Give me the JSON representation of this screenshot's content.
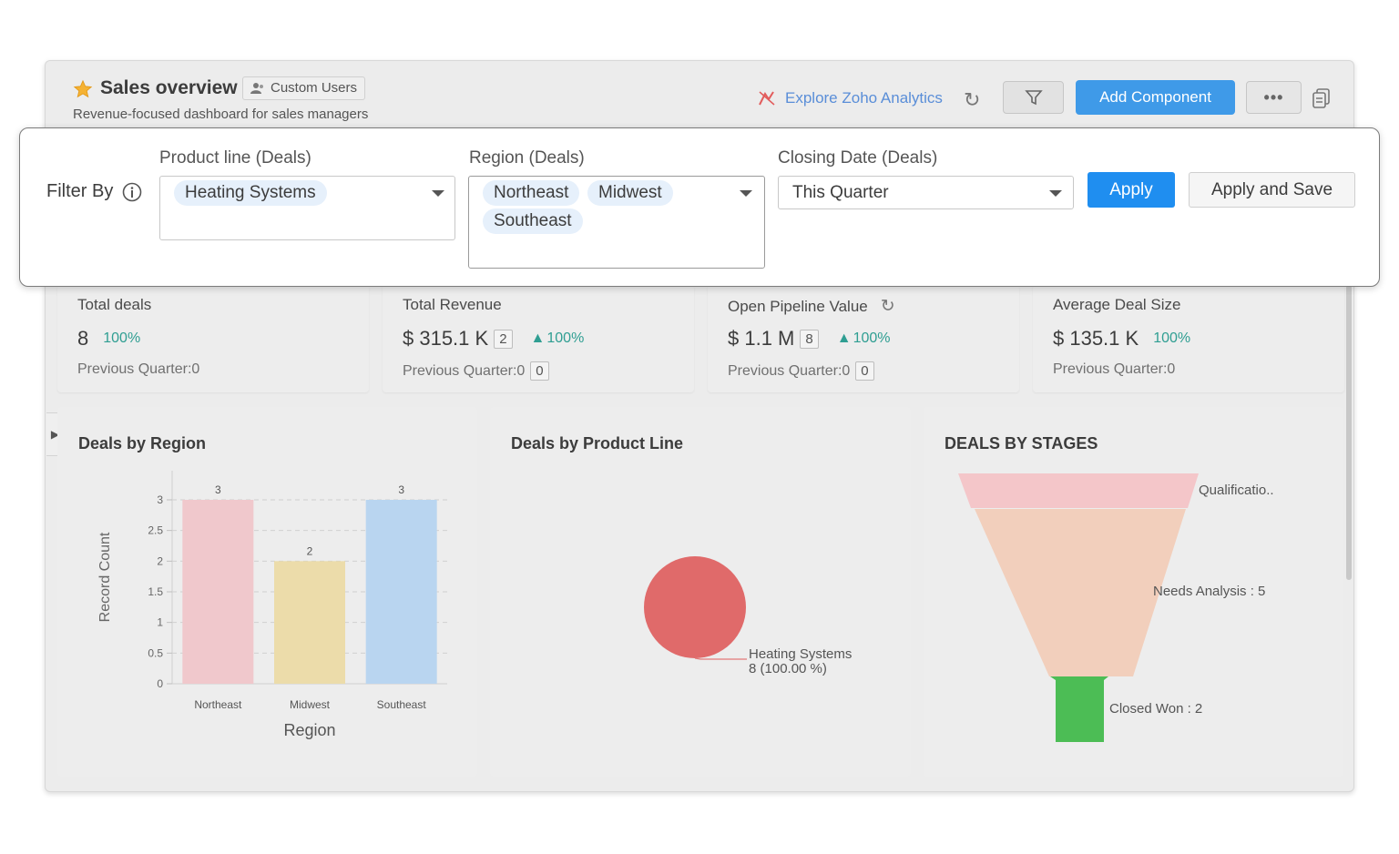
{
  "header": {
    "title": "Sales overview",
    "custom_users_label": "Custom Users",
    "subtitle": "Revenue-focused dashboard for sales managers",
    "explore_label": "Explore Zoho Analytics",
    "add_component_label": "Add Component",
    "more_label": "•••"
  },
  "filter": {
    "filter_by_label": "Filter By",
    "product_line": {
      "label": "Product line (Deals)",
      "selected": [
        "Heating Systems"
      ]
    },
    "region": {
      "label": "Region (Deals)",
      "selected": [
        "Northeast",
        "Midwest",
        "Southeast"
      ]
    },
    "closing_date": {
      "label": "Closing Date (Deals)",
      "value": "This Quarter"
    },
    "apply_label": "Apply",
    "apply_save_label": "Apply and Save"
  },
  "kpis": [
    {
      "title": "Total deals",
      "value": "8",
      "change": "100%",
      "prev": "Previous Quarter:0"
    },
    {
      "title": "Total Revenue",
      "value": "$ 315.1 K",
      "count": "2",
      "change": "100%",
      "prev": "Previous Quarter:0",
      "prev_box": "0"
    },
    {
      "title": "Open Pipeline Value",
      "value": "$ 1.1 M",
      "count": "8",
      "change": "100%",
      "prev": "Previous Quarter:0",
      "prev_box": "0"
    },
    {
      "title": "Average Deal Size",
      "value": "$ 135.1 K",
      "change": "100%",
      "prev": "Previous Quarter:0"
    }
  ],
  "panels": {
    "region_title": "Deals by Region",
    "product_title": "Deals by Product Line",
    "stages_title": "DEALS BY STAGES"
  },
  "colors": {
    "accent": "#1f8ef0",
    "positive": "#2f9e92",
    "bar_northeast": "#f0c8cc",
    "bar_midwest": "#ecdcaa",
    "bar_southeast": "#b9d5f0",
    "pie": "#e06a6a",
    "funnel_qual": "#f4c6c9",
    "funnel_needs": "#f2cfbc",
    "funnel_won": "#4cbd55"
  },
  "chart_data": [
    {
      "type": "bar",
      "title": "Deals by Region",
      "xlabel": "Region",
      "ylabel": "Record Count",
      "categories": [
        "Northeast",
        "Midwest",
        "Southeast"
      ],
      "values": [
        3,
        2,
        3
      ],
      "ylim": [
        0,
        3
      ],
      "yticks": [
        "0",
        "0.5",
        "1",
        "1.5",
        "2",
        "2.5",
        "3"
      ],
      "data_labels": [
        "3",
        "2",
        "3"
      ],
      "grid": true
    },
    {
      "type": "pie",
      "title": "Deals by Product Line",
      "slices": [
        {
          "label": "Heating Systems",
          "value": 8,
          "percent_label": "8 (100.00 %)"
        }
      ]
    },
    {
      "type": "funnel",
      "title": "DEALS BY STAGES",
      "stages": [
        {
          "label": "Qualificatio..",
          "value": 1
        },
        {
          "label": "Needs Analysis : 5",
          "value": 5
        },
        {
          "label": "Closed Won : 2",
          "value": 2
        }
      ]
    }
  ]
}
